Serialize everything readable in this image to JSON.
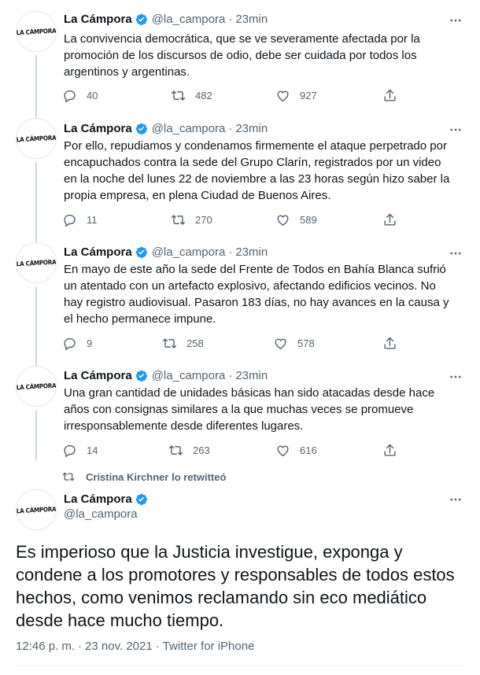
{
  "colors": {
    "text": "#0f1419",
    "secondary": "#536471",
    "verified": "#1d9bf0",
    "thread_line": "#cfd9de"
  },
  "avatar_label": "LA CÁMPORA",
  "tweets": [
    {
      "name": "La Cámpora",
      "handle": "@la_campora",
      "separator": "·",
      "time": "23min",
      "text": "La convivencia democrática, que se ve severamente afectada por la promoción de los discursos de odio, debe ser cuidada por todos los argentinos y argentinas.",
      "replies": "40",
      "retweets": "482",
      "likes": "927"
    },
    {
      "name": "La Cámpora",
      "handle": "@la_campora",
      "separator": "·",
      "time": "23min",
      "text": "Por ello, repudiamos y condenamos firmemente el ataque perpetrado por encapuchados contra la sede del Grupo Clarín, registrados por un video en la noche del lunes 22 de noviembre a las 23 horas según hizo saber la propia empresa, en plena Ciudad de Buenos Aires.",
      "replies": "11",
      "retweets": "270",
      "likes": "589"
    },
    {
      "name": "La Cámpora",
      "handle": "@la_campora",
      "separator": "·",
      "time": "23min",
      "text": "En mayo de este año la sede del Frente de Todos en Bahía Blanca sufrió un atentado con un artefacto explosivo, afectando edificios vecinos. No hay registro audiovisual. Pasaron 183 días, no hay avances en la causa y el hecho permanece impune.",
      "replies": "9",
      "retweets": "258",
      "likes": "578"
    },
    {
      "name": "La Cámpora",
      "handle": "@la_campora",
      "separator": "·",
      "time": "23min",
      "text": "Una gran cantidad de unidades básicas han sido atacadas desde hace años con consignas similares a la que muchas veces se promueve irresponsablemente desde diferentes lugares.",
      "replies": "14",
      "retweets": "263",
      "likes": "616"
    }
  ],
  "retweet_context": "Cristina Kirchner lo retwitteó",
  "main_tweet": {
    "name": "La Cámpora",
    "handle": "@la_campora",
    "text": "Es imperioso que la Justicia investigue, exponga y condene a los promotores y responsables de todos estos hechos, como venimos reclamando sin eco mediático desde hace mucho tiempo.",
    "time": "12:46 p. m.",
    "date": "23 nov. 2021",
    "source": "Twitter for iPhone",
    "separator": "·"
  }
}
